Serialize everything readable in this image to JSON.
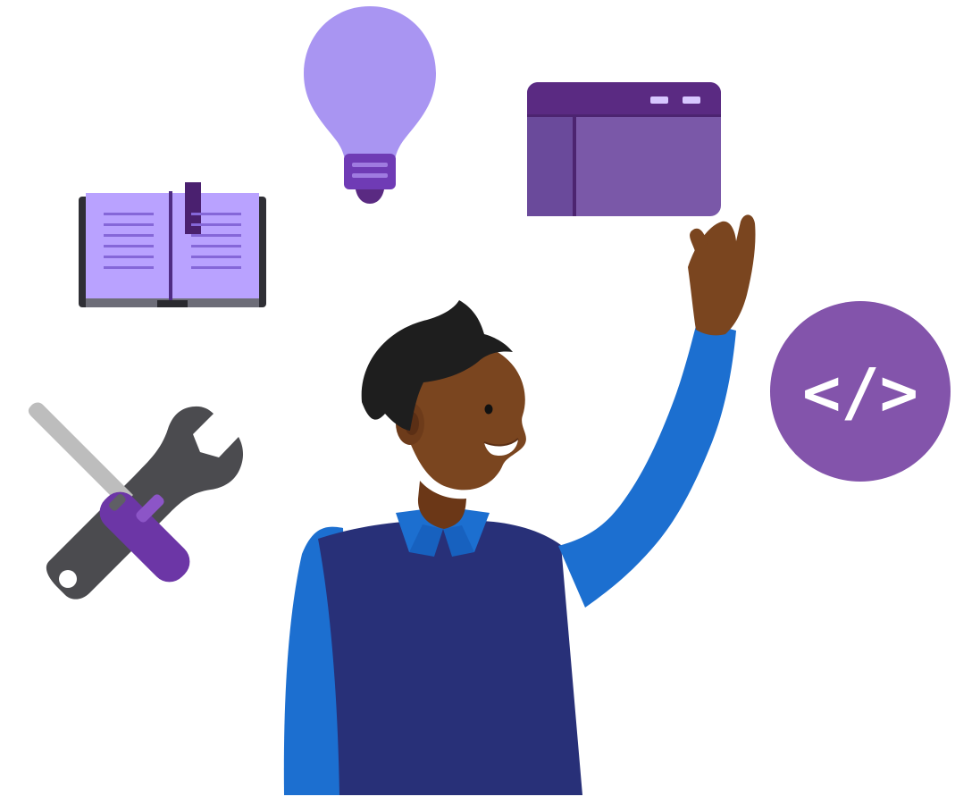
{
  "illustration": {
    "background_color": "#ffffff",
    "code_symbol": "</>",
    "icons": [
      "lightbulb-icon",
      "browser-window-icon",
      "open-book-icon",
      "screwdriver-wrench-icon",
      "code-brackets-icon"
    ],
    "colors": {
      "lavender": "#a995f2",
      "purple": "#7a58a8",
      "dark_purple": "#5a2a82",
      "charcoal": "#3a3a3a",
      "gray": "#6c6c6c",
      "navy": "#283078",
      "blue": "#1c6fd0",
      "skin": "#7a451f",
      "hair": "#1e1e1e"
    }
  }
}
